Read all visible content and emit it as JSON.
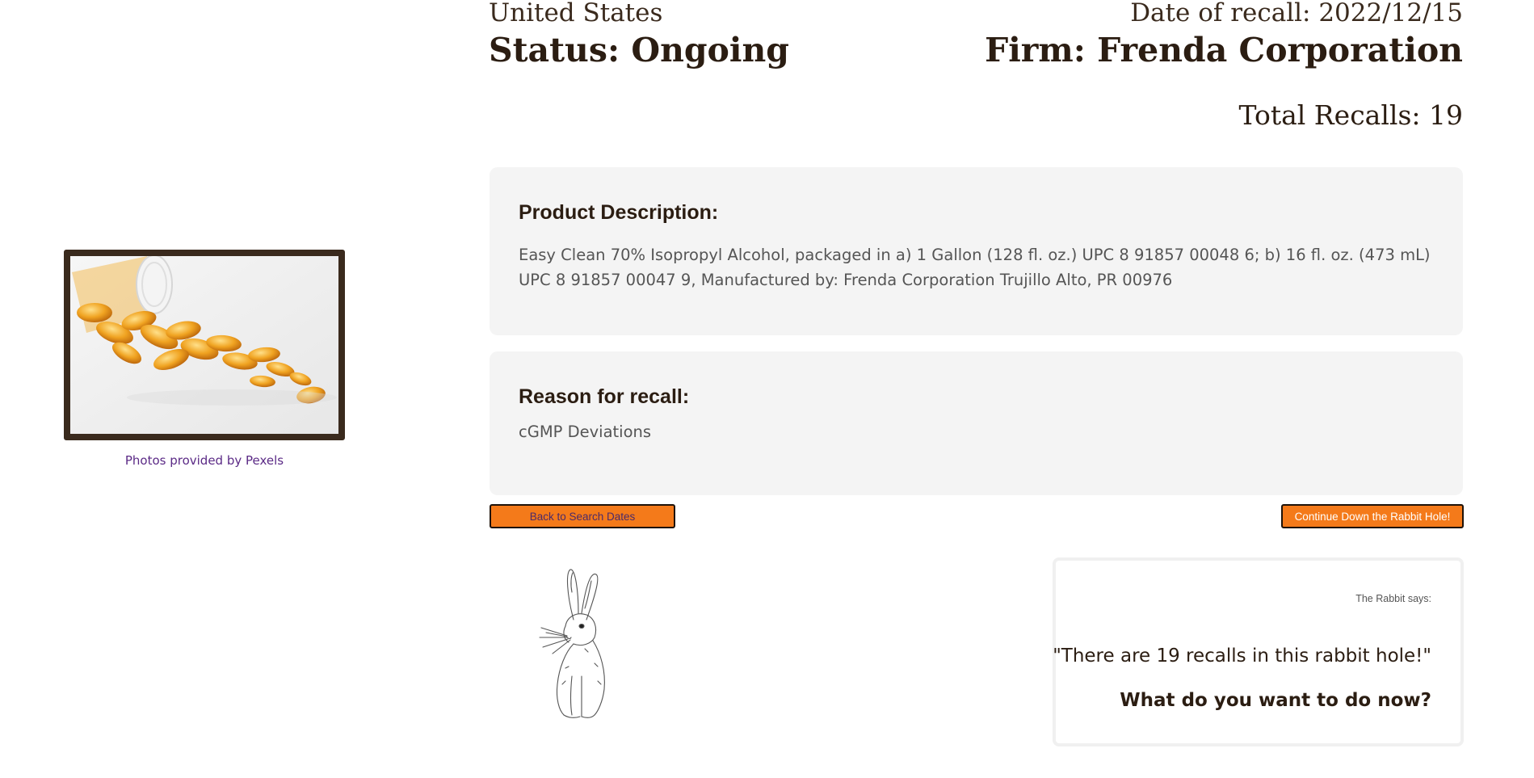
{
  "header": {
    "country": "United States",
    "status": "Status: Ongoing",
    "recall_date": "Date of recall: 2022/12/15",
    "firm": "Firm: Frenda Corporation",
    "total_recalls": "Total Recalls: 19"
  },
  "photo": {
    "alt_icon": "pill-bottle-photo",
    "credit": "Photos provided by Pexels"
  },
  "product": {
    "heading": "Product Description:",
    "text": "Easy Clean 70% Isopropyl Alcohol, packaged in a) 1 Gallon (128 fl. oz.) UPC 8 91857 00048 6; b) 16 fl. oz. (473 mL) UPC 8 91857 00047 9, Manufactured by: Frenda Corporation Trujillo Alto, PR 00976"
  },
  "reason": {
    "heading": "Reason for recall:",
    "text": "cGMP Deviations"
  },
  "buttons": {
    "back": "Back to Search Dates",
    "continue": "Continue Down the Rabbit Hole!"
  },
  "rabbit": {
    "icon": "rabbit-illustration",
    "says_label": "The Rabbit says:",
    "quote": "\"There are 19 recalls in this rabbit hole!\"",
    "prompt": "What do you want to do now?"
  },
  "colors": {
    "accent_button": "#f47a1a",
    "text_dark": "#2b1d12",
    "panel_bg": "#f4f4f4",
    "frame_border": "#3a2a1d",
    "link_purple": "#5b2a86"
  }
}
